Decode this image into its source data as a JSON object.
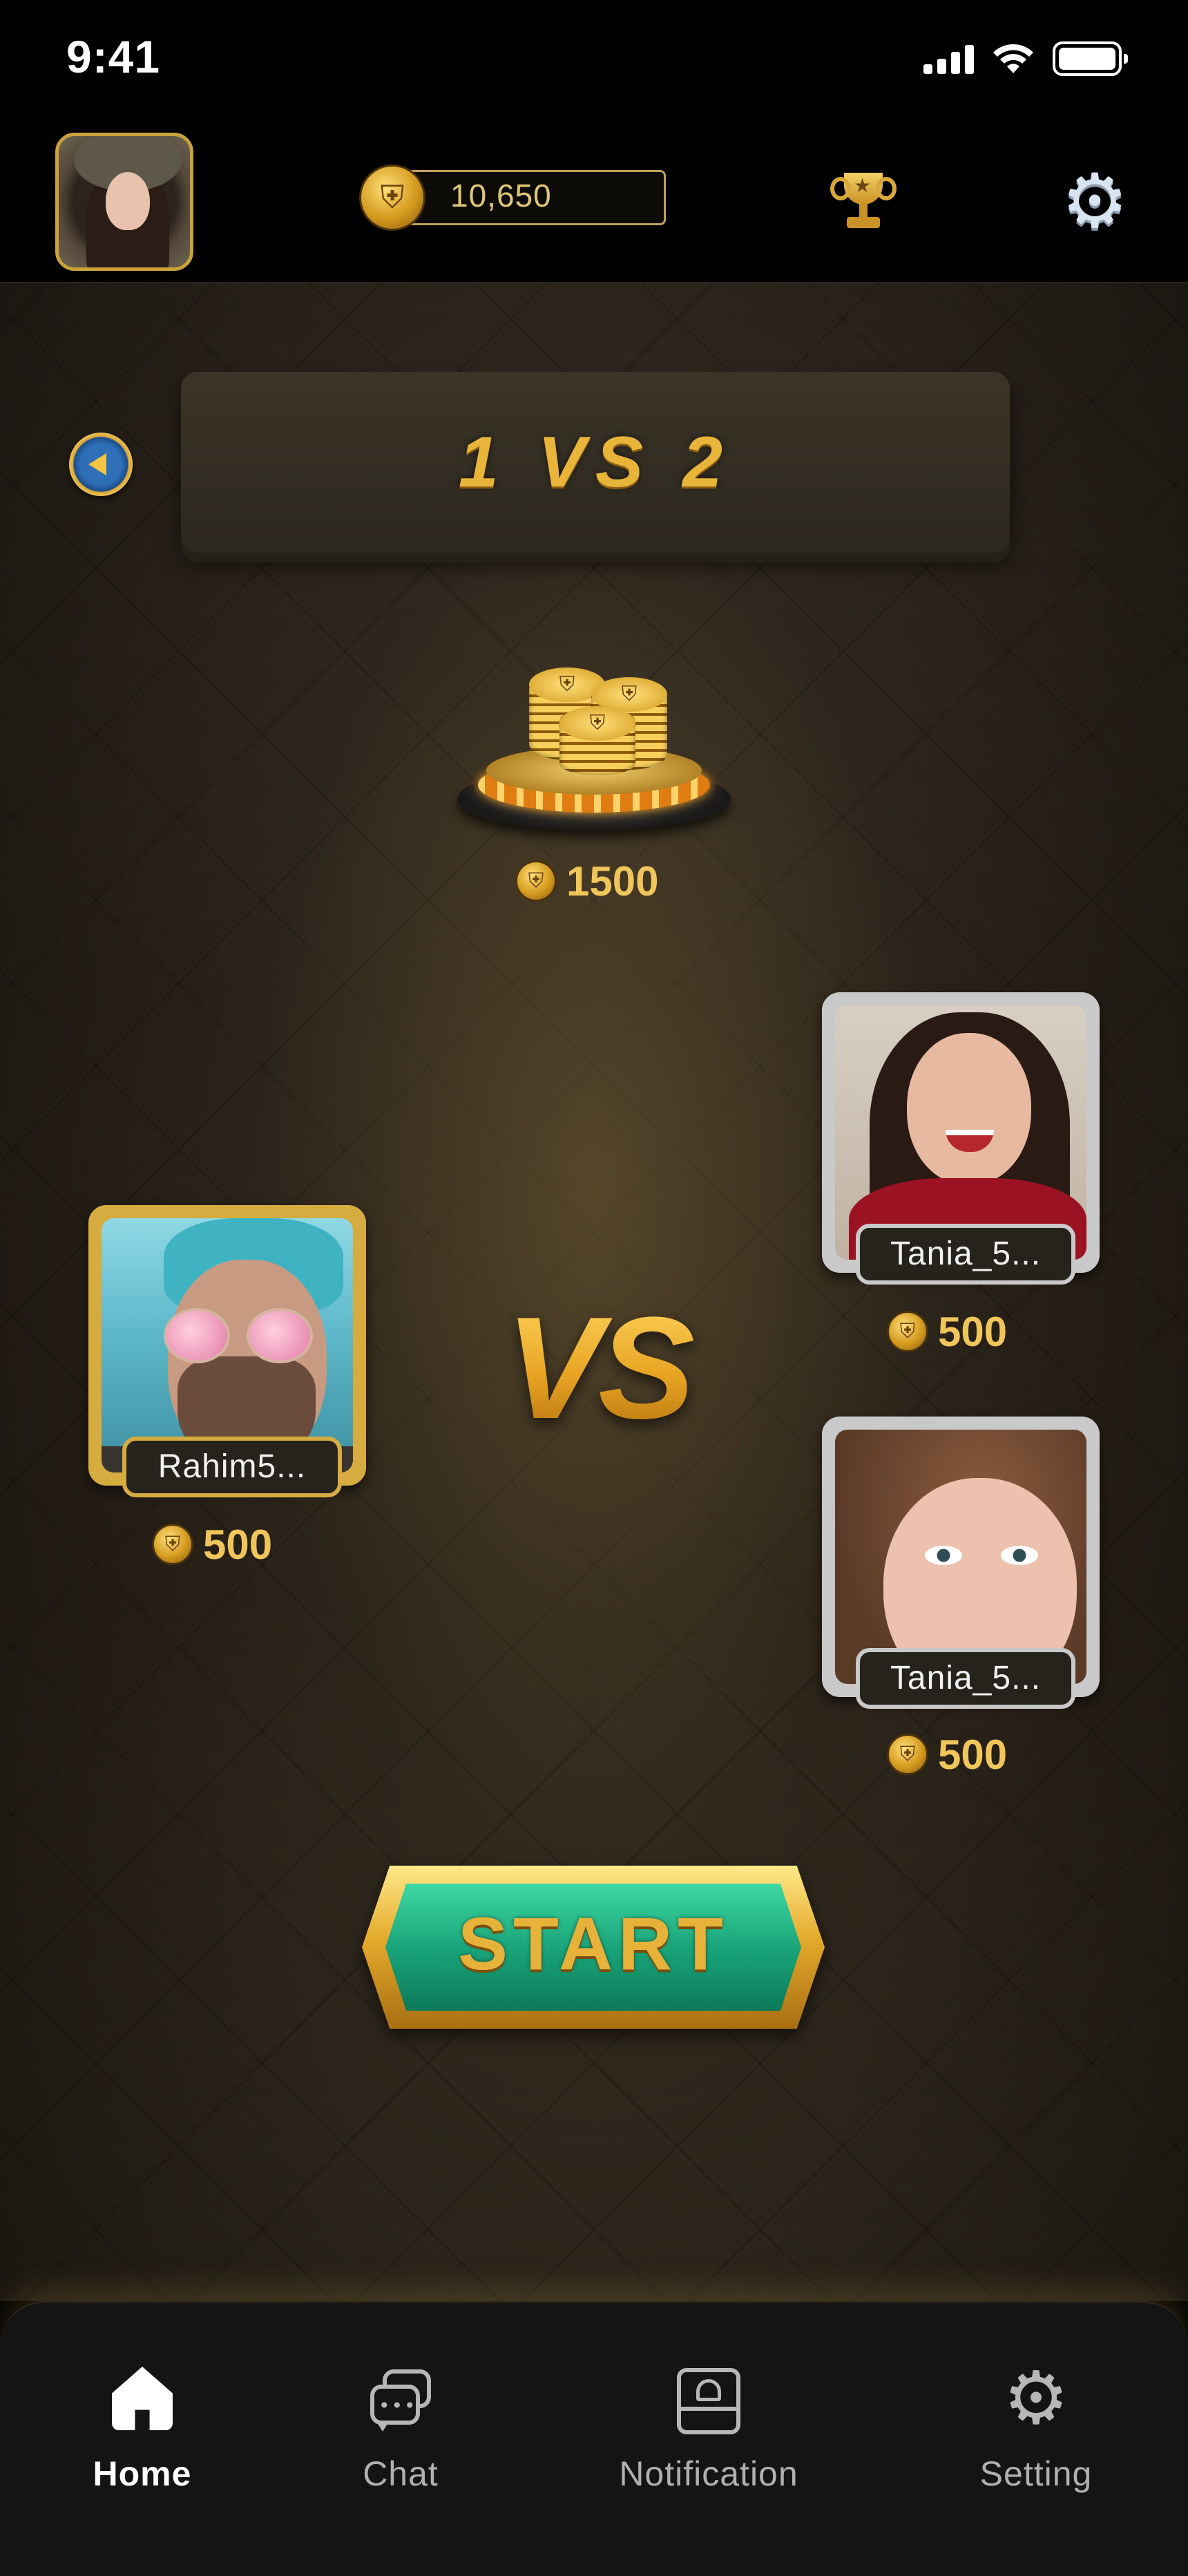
{
  "status_bar": {
    "time": "9:41"
  },
  "header": {
    "coin_balance": "10,650",
    "icons": [
      "coin-icon",
      "trophy-icon",
      "gear-icon"
    ]
  },
  "match": {
    "title": "1 VS 2",
    "pot_amount": "1500",
    "vs_label": "VS",
    "players": [
      {
        "name": "Rahim5...",
        "bet": "500",
        "frame_color": "#d6ab3f"
      },
      {
        "name": "Tania_5...",
        "bet": "500",
        "frame_color": "#c9c9c9"
      },
      {
        "name": "Tania_5...",
        "bet": "500",
        "frame_color": "#c9c9c9"
      }
    ],
    "start_label": "START"
  },
  "bottom_nav": {
    "items": [
      {
        "label": "Home",
        "icon": "home-icon",
        "active": true
      },
      {
        "label": "Chat",
        "icon": "chat-icon",
        "active": false
      },
      {
        "label": "Notification",
        "icon": "notification-icon",
        "active": false
      },
      {
        "label": "Setting",
        "icon": "setting-icon",
        "active": false
      }
    ]
  },
  "colors": {
    "accent_gold": "#e8b53a",
    "start_green": "#1aa57a",
    "background": "#2b241b"
  }
}
